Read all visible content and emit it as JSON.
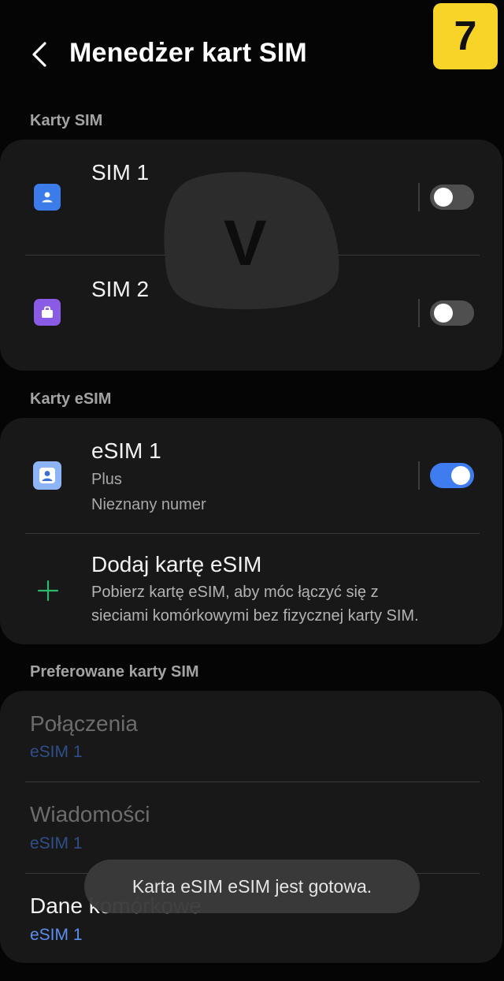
{
  "header": {
    "back_icon": "chevron-left-icon",
    "title": "Menedżer kart SIM",
    "badge": "7",
    "badge_color": "#f9d428"
  },
  "sim_section": {
    "label": "Karty SIM",
    "items": [
      {
        "name": "SIM 1",
        "icon": "sim-contact-icon",
        "icon_color": "#3c7cea",
        "enabled": false
      },
      {
        "name": "SIM 2",
        "icon": "sim-briefcase-icon",
        "icon_color": "#8a5ce6",
        "enabled": false
      }
    ]
  },
  "watermark": {
    "letter": "V"
  },
  "esim_section": {
    "label": "Karty eSIM",
    "items": [
      {
        "name": "eSIM 1",
        "carrier": "Plus",
        "number": "Nieznany numer",
        "icon": "esim-contact-icon",
        "icon_color": "#8db4f7",
        "enabled": true
      }
    ],
    "add": {
      "icon": "plus-icon",
      "title": "Dodaj kartę eSIM",
      "description_line1": "Pobierz kartę eSIM, aby móc łączyć się z",
      "description_line2": "sieciami komórkowymi bez fizycznej karty SIM."
    }
  },
  "preferred_section": {
    "label": "Preferowane karty SIM",
    "items": [
      {
        "title": "Połączenia",
        "value": "eSIM 1"
      },
      {
        "title": "Wiadomości",
        "value": "eSIM 1"
      },
      {
        "title": "Dane komórkowe",
        "value": "eSIM 1"
      }
    ]
  },
  "toast": {
    "text": "Karta eSIM eSIM jest gotowa."
  },
  "colors": {
    "accent": "#3e7cf0",
    "card": "#181818",
    "background": "#050505",
    "plus": "#2fb86a"
  }
}
